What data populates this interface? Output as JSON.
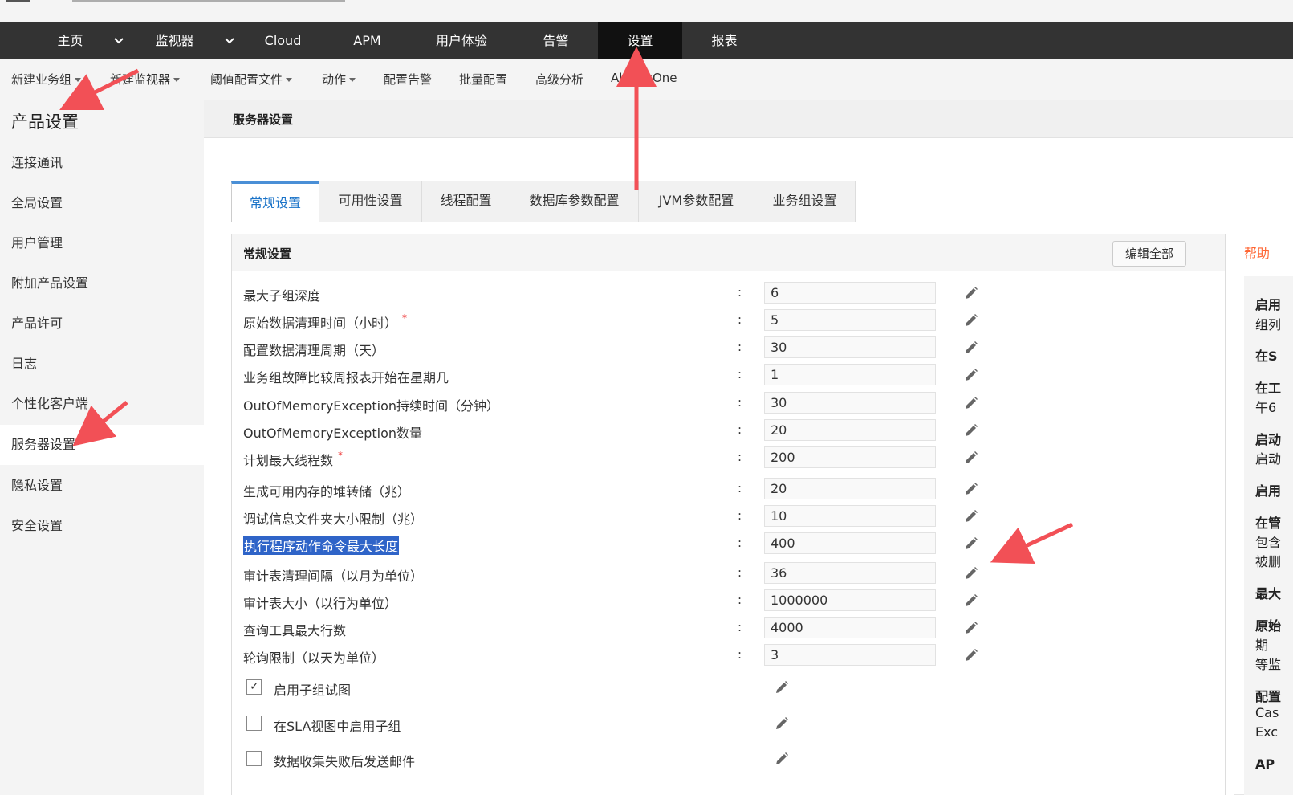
{
  "main_nav": {
    "items": [
      "主页",
      "监视器",
      "Cloud",
      "APM",
      "用户体验",
      "告警",
      "设置",
      "报表"
    ],
    "active": "设置"
  },
  "sub_nav": {
    "items": [
      {
        "label": "新建业务组",
        "dropdown": true
      },
      {
        "label": "新建监视器",
        "dropdown": true
      },
      {
        "label": "阈值配置文件",
        "dropdown": true
      },
      {
        "label": "动作",
        "dropdown": true
      },
      {
        "label": "配置告警",
        "dropdown": false
      },
      {
        "label": "批量配置",
        "dropdown": false
      },
      {
        "label": "高级分析",
        "dropdown": false
      },
      {
        "label": "AlarmsOne",
        "dropdown": false
      }
    ]
  },
  "sidebar": {
    "title": "产品设置",
    "items": [
      "连接通讯",
      "全局设置",
      "用户管理",
      "附加产品设置",
      "产品许可",
      "日志",
      "个性化客户端",
      "服务器设置",
      "隐私设置",
      "安全设置"
    ],
    "active": "服务器设置"
  },
  "content": {
    "header": "服务器设置",
    "tabs": [
      "常规设置",
      "可用性设置",
      "线程配置",
      "数据库参数配置",
      "JVM参数配置",
      "业务组设置"
    ],
    "active_tab": "常规设置",
    "panel": {
      "title": "常规设置",
      "edit_all": "编辑全部",
      "colon": ":",
      "fields": [
        {
          "label": "最大子组深度",
          "required": false,
          "value": "6"
        },
        {
          "label": "原始数据清理时间（小时）",
          "required": true,
          "value": "5"
        },
        {
          "label": "配置数据清理周期（天）",
          "required": false,
          "value": "30"
        },
        {
          "label": "业务组故障比较周报表开始在星期几",
          "required": false,
          "value": "1"
        },
        {
          "label": "OutOfMemoryException持续时间（分钟）",
          "required": false,
          "value": "30"
        },
        {
          "label": "OutOfMemoryException数量",
          "required": false,
          "value": "20"
        },
        {
          "label": "计划最大线程数",
          "required": true,
          "value": "200"
        },
        {
          "label": "生成可用内存的堆转储（兆）",
          "required": false,
          "value": "20"
        },
        {
          "label": "调试信息文件夹大小限制（兆）",
          "required": false,
          "value": "10"
        },
        {
          "label": "执行程序动作命令最大长度",
          "required": false,
          "value": "400",
          "highlighted": true
        },
        {
          "label": "审计表清理间隔（以月为单位）",
          "required": false,
          "value": "36"
        },
        {
          "label": "审计表大小（以行为单位）",
          "required": false,
          "value": "1000000"
        },
        {
          "label": "查询工具最大行数",
          "required": false,
          "value": "4000"
        },
        {
          "label": "轮询限制（以天为单位）",
          "required": false,
          "value": "3"
        }
      ],
      "checkboxes": [
        {
          "label": "启用子组试图",
          "checked": true
        },
        {
          "label": "在SLA视图中启用子组",
          "checked": false
        },
        {
          "label": "数据收集失败后发送邮件",
          "checked": false
        }
      ]
    },
    "help": {
      "title": "帮助",
      "snippets": [
        "启用",
        "组列",
        "在S",
        "在工",
        "午6",
        "启动",
        "启动",
        "启用",
        "在管",
        "包含",
        "被删",
        "最大",
        "原始",
        "期",
        "等监",
        "配置",
        "Cas",
        "Exc",
        "AP"
      ]
    }
  },
  "required_mark": "*",
  "colors": {
    "nav_bg": "#333333",
    "nav_active": "#111111",
    "tab_active_text": "#1a73c8",
    "selection": "#2f64c8",
    "help_title": "#ff6633",
    "annotation_arrow": "#f25056"
  },
  "icons": [
    "chevron-down-icon",
    "pencil-icon",
    "checkbox-icon",
    "caret-down-icon",
    "annotation-arrow"
  ]
}
